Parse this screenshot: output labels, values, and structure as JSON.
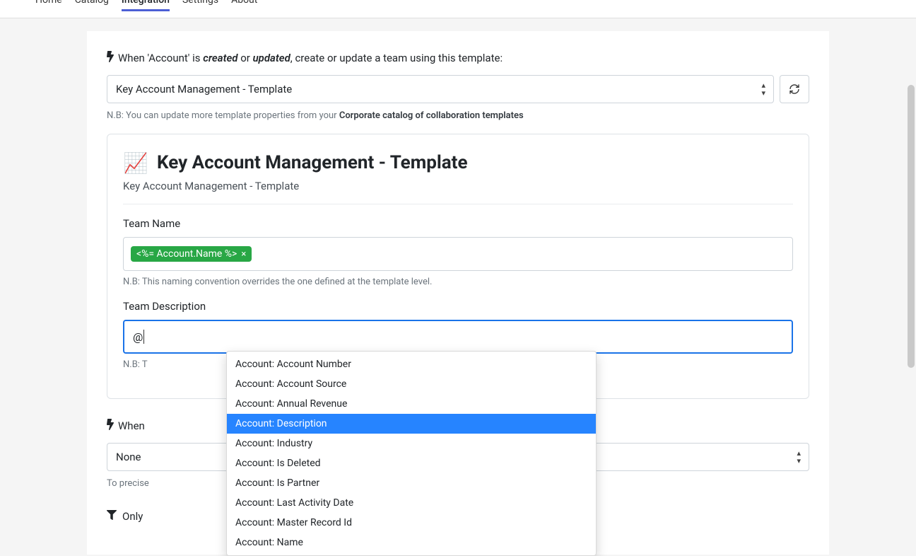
{
  "nav": {
    "items": [
      "Home",
      "Catalog",
      "Integration",
      "Settings",
      "About"
    ],
    "activeIndex": 2
  },
  "trigger": {
    "prefix": "When 'Account' is ",
    "created": "created",
    "or": " or ",
    "updated": "updated",
    "suffix": ", create or update a team using this template:"
  },
  "templateSelect": {
    "value": "Key Account Management - Template"
  },
  "nb1": {
    "prefix": "N.B: You can update more template properties from your ",
    "link": "Corporate catalog of collaboration templates"
  },
  "card": {
    "emoji": "📈",
    "title": "Key Account Management - Template",
    "subtitle": "Key Account Management - Template",
    "teamNameLabel": "Team Name",
    "tagText": "<%= Account.Name %>",
    "teamNameNb": "N.B: This naming convention overrides the one defined at the template level.",
    "teamDescLabel": "Team Description",
    "descValue": "@",
    "teamDescNbPrefix": "N.B: T"
  },
  "autocomplete": {
    "items": [
      "Account: Account Number",
      "Account: Account Source",
      "Account: Annual Revenue",
      "Account: Description",
      "Account: Industry",
      "Account: Is Deleted",
      "Account: Is Partner",
      "Account: Last Activity Date",
      "Account: Master Record Id",
      "Account: Name"
    ],
    "highlightIndex": 3
  },
  "trigger2": {
    "prefix": "When"
  },
  "select2": {
    "value": "None"
  },
  "toPrecise": {
    "leftFragment": "To precise",
    "rightFragment": "\"."
  },
  "only": {
    "text": "Only"
  }
}
